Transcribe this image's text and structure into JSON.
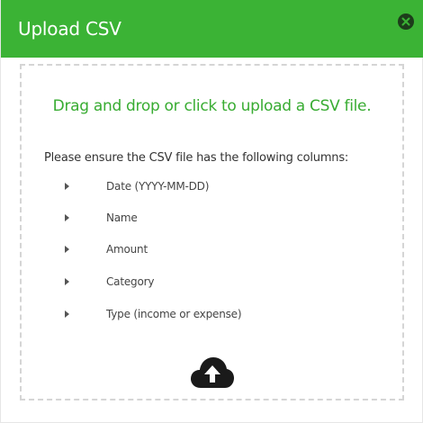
{
  "dialog": {
    "title": "Upload CSV",
    "close_icon": "close-circle-icon"
  },
  "dropzone": {
    "title": "Drag and drop or click to upload a CSV file.",
    "intro": "Please ensure the CSV file has the following columns:",
    "columns": [
      "Date (YYYY-MM-DD)",
      "Name",
      "Amount",
      "Category",
      "Type (income or expense)"
    ],
    "bullet_icon": "caret-right-icon",
    "upload_icon": "cloud-upload-icon"
  },
  "colors": {
    "header_bg": "#3bb335",
    "accent_text": "#38ac32",
    "close_bg": "#1d3d1b",
    "dash_border": "#d5d5d5"
  }
}
